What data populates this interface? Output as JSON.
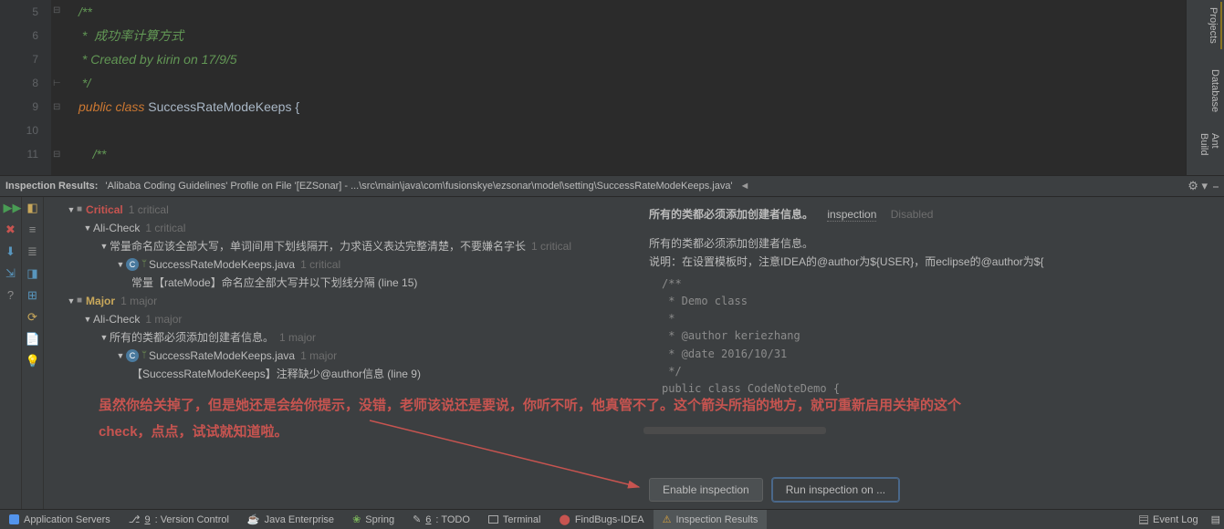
{
  "editor": {
    "lines": [
      "5",
      "6",
      "7",
      "8",
      "9",
      "10",
      "11"
    ],
    "code": {
      "l1": "/**",
      "l2": " *  成功率计算方式",
      "l3": " * Created by kirin on 17/9/5",
      "l4": " */",
      "l5_kw1": "public ",
      "l5_kw2": "class ",
      "l5_cls": "SuccessRateModeKeeps ",
      "l5_brc": "{",
      "l6": "",
      "l7": "/**"
    }
  },
  "right_tabs": {
    "t1": "Projects",
    "t2": "Database",
    "t3": "Ant Build"
  },
  "panel": {
    "title": "Inspection Results:",
    "file": "'Alibaba Coding Guidelines' Profile on File '[EZSonar] - ...\\src\\main\\java\\com\\fusionskye\\ezsonar\\model\\setting\\SuccessRateModeKeeps.java'"
  },
  "tree": {
    "critical": "Critical",
    "critical_cnt": "1 critical",
    "alicheck": "Ali-Check",
    "ali_c_cnt": "1 critical",
    "rule1": "常量命名应该全部大写，单词间用下划线隔开，力求语义表达完整清楚，不要嫌名字长",
    "rule1_cnt": "1 critical",
    "file_c": "SuccessRateModeKeeps.java",
    "file_c_cnt": "1 critical",
    "leaf_c": "常量【rateMode】命名应全部大写并以下划线分隔 (line 15)",
    "major": "Major",
    "major_cnt": "1 major",
    "ali_m_cnt": "1 major",
    "rule2": "所有的类都必须添加创建者信息。",
    "rule2_cnt": "1 major",
    "file_m": "SuccessRateModeKeeps.java",
    "file_m_cnt": "1 major",
    "leaf_m": "【SuccessRateModeKeeps】注释缺少@author信息 (line 9)"
  },
  "annotation": {
    "l1": "虽然你给关掉了，但是她还是会给你提示，没错，老师该说还是要说，你听不听，他真管不了。这个箭头所指的地方，就可重新启用关掉的这个",
    "l2": "check，点点，试试就知道啦。"
  },
  "detail": {
    "title": "所有的类都必须添加创建者信息。",
    "link": "inspection",
    "disabled": "Disabled",
    "desc1": "所有的类都必须添加创建者信息。",
    "desc2": "说明：在设置模板时，注意IDEA的@author为${USER}，而eclipse的@author为${",
    "code": "/**\n * Demo class\n *\n * @author keriezhang\n * @date 2016/10/31\n */\npublic class CodeNoteDemo {",
    "btn1": "Enable inspection",
    "btn2": "Run inspection on ..."
  },
  "status": {
    "appservers": "Application Servers",
    "vcs_key": "9",
    "vcs": ": Version Control",
    "javaee": "Java Enterprise",
    "spring": "Spring",
    "todo_key": "6",
    "todo": ": TODO",
    "terminal": "Terminal",
    "findbugs": "FindBugs-IDEA",
    "inspres": "Inspection Results",
    "eventlog": "Event Log"
  }
}
